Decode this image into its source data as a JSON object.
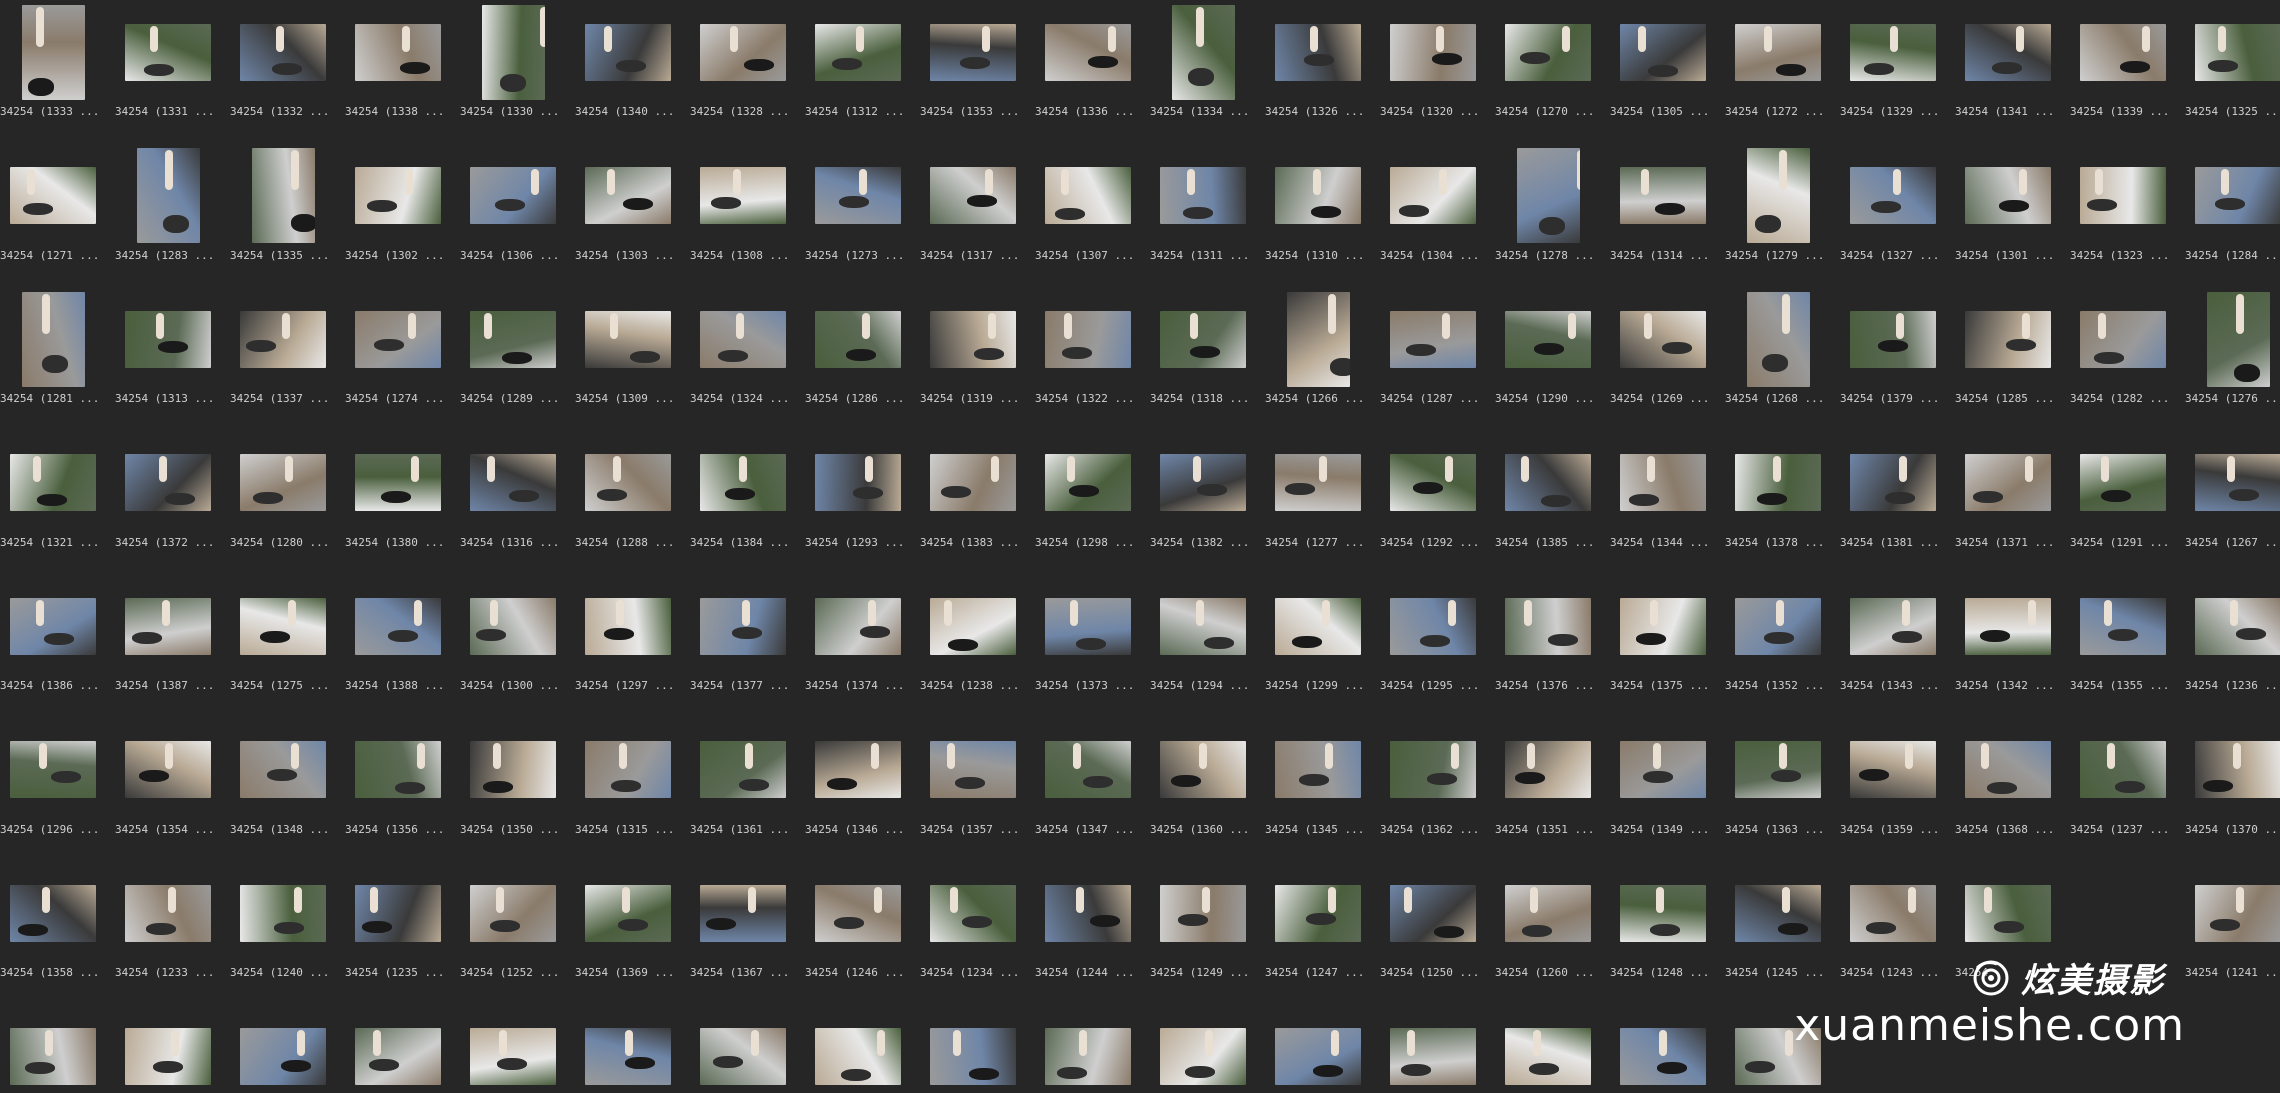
{
  "thumbnails": {
    "rows": [
      [
        "34254 (1333 ...",
        "34254 (1331 ...",
        "34254 (1332 ...",
        "34254 (1338 ...",
        "34254 (1330 ...",
        "34254 (1340 ...",
        "34254 (1328 ...",
        "34254 (1312 ...",
        "34254 (1353 ...",
        "34254 (1336 ...",
        "34254 (1334 ...",
        "34254 (1326 ...",
        "34254 (1320 ...",
        "34254 (1270 ...",
        "34254 (1305 ...",
        "34254 (1272 ...",
        "34254 (1329 ...",
        "34254 (1341 ...",
        "34254 (1339 ...",
        "34254 (1325 ..."
      ],
      [
        "34254 (1271 ...",
        "34254 (1283 ...",
        "34254 (1335 ...",
        "34254 (1302 ...",
        "34254 (1306 ...",
        "34254 (1303 ...",
        "34254 (1308 ...",
        "34254 (1273 ...",
        "34254 (1317 ...",
        "34254 (1307 ...",
        "34254 (1311 ...",
        "34254 (1310 ...",
        "34254 (1304 ...",
        "34254 (1278 ...",
        "34254 (1314 ...",
        "34254 (1279 ...",
        "34254 (1327 ...",
        "34254 (1301 ...",
        "34254 (1323 ...",
        "34254 (1284 ..."
      ],
      [
        "34254 (1281 ...",
        "34254 (1313 ...",
        "34254 (1337 ...",
        "34254 (1274 ...",
        "34254 (1289 ...",
        "34254 (1309 ...",
        "34254 (1324 ...",
        "34254 (1286 ...",
        "34254 (1319 ...",
        "34254 (1322 ...",
        "34254 (1318 ...",
        "34254 (1266 ...",
        "34254 (1287 ...",
        "34254 (1290 ...",
        "34254 (1269 ...",
        "34254 (1268 ...",
        "34254 (1379 ...",
        "34254 (1285 ...",
        "34254 (1282 ...",
        "34254 (1276 ..."
      ],
      [
        "34254 (1321 ...",
        "34254 (1372 ...",
        "34254 (1280 ...",
        "34254 (1380 ...",
        "34254 (1316 ...",
        "34254 (1288 ...",
        "34254 (1384 ...",
        "34254 (1293 ...",
        "34254 (1383 ...",
        "34254 (1298 ...",
        "34254 (1382 ...",
        "34254 (1277 ...",
        "34254 (1292 ...",
        "34254 (1385 ...",
        "34254 (1344 ...",
        "34254 (1378 ...",
        "34254 (1381 ...",
        "34254 (1371 ...",
        "34254 (1291 ...",
        "34254 (1267 ..."
      ],
      [
        "34254 (1386 ...",
        "34254 (1387 ...",
        "34254 (1275 ...",
        "34254 (1388 ...",
        "34254 (1300 ...",
        "34254 (1297 ...",
        "34254 (1377 ...",
        "34254 (1374 ...",
        "34254 (1238 ...",
        "34254 (1373 ...",
        "34254 (1294 ...",
        "34254 (1299 ...",
        "34254 (1295 ...",
        "34254 (1376 ...",
        "34254 (1375 ...",
        "34254 (1352 ...",
        "34254 (1343 ...",
        "34254 (1342 ...",
        "34254 (1355 ...",
        "34254 (1236 ..."
      ],
      [
        "34254 (1296 ...",
        "34254 (1354 ...",
        "34254 (1348 ...",
        "34254 (1356 ...",
        "34254 (1350 ...",
        "34254 (1315 ...",
        "34254 (1361 ...",
        "34254 (1346 ...",
        "34254 (1357 ...",
        "34254 (1347 ...",
        "34254 (1360 ...",
        "34254 (1345 ...",
        "34254 (1362 ...",
        "34254 (1351 ...",
        "34254 (1349 ...",
        "34254 (1363 ...",
        "34254 (1359 ...",
        "34254 (1368 ...",
        "34254 (1237 ...",
        "34254 (1370 ..."
      ],
      [
        "34254 (1358 ...",
        "34254 (1233 ...",
        "34254 (1240 ...",
        "34254 (1235 ...",
        "34254 (1252 ...",
        "34254 (1369 ...",
        "34254 (1367 ...",
        "34254 (1246 ...",
        "34254 (1234 ...",
        "34254 (1244 ...",
        "34254 (1249 ...",
        "34254 (1247 ...",
        "34254 (1250 ...",
        "34254 (1260 ...",
        "34254 (1248 ...",
        "34254 (1245 ...",
        "34254 (1243 ...",
        "34254",
        "",
        "34254 (1241 ..."
      ],
      [
        "",
        "",
        "",
        "",
        "",
        "",
        "",
        "",
        "",
        "",
        "",
        "",
        "",
        "",
        "",
        ""
      ]
    ],
    "portrait": [
      [
        0,
        4,
        10
      ],
      [
        1,
        2,
        13,
        15
      ],
      [
        0,
        11,
        15,
        19
      ],
      [],
      [],
      [],
      [],
      []
    ]
  },
  "watermark": {
    "brand_cn": "炫美摄影",
    "url": "xuanmeishe.com",
    "logo_icon": "camera-swirl-icon",
    "color": "#ffffff"
  },
  "colors": {
    "background": "#262626",
    "caption": "#d0d0d0",
    "palettes": [
      "#cfcfcf",
      "#9a9a9a",
      "#3a3a3a",
      "#e8e8e8",
      "#5b6a55",
      "#8a7b6a",
      "#6f86a8",
      "#b9aa95",
      "#4a5f3d"
    ]
  }
}
